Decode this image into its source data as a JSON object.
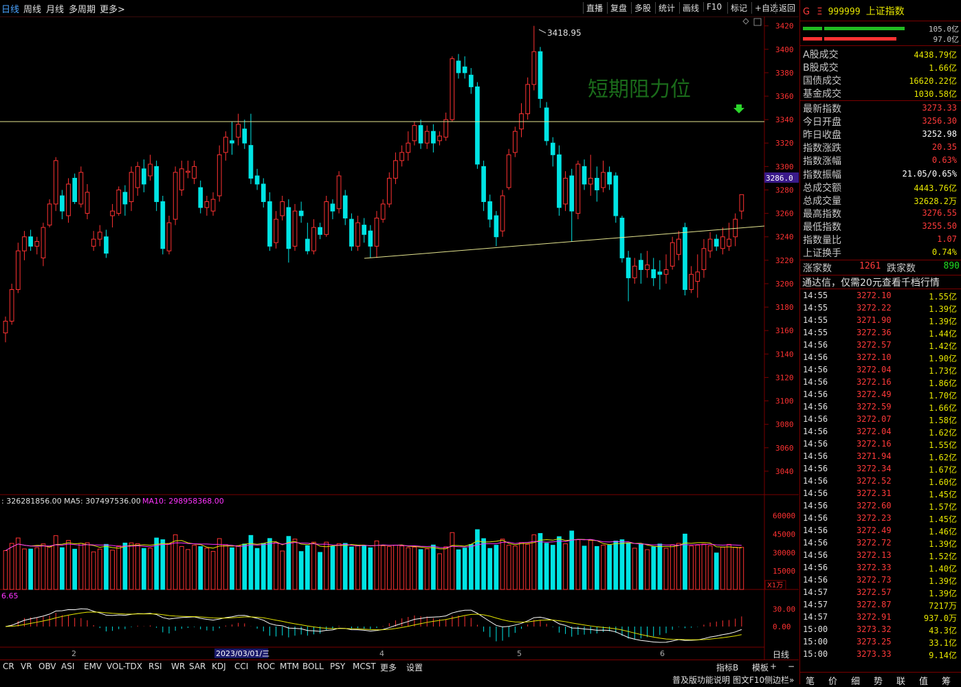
{
  "toolbar": {
    "periods": [
      "日线",
      "周线",
      "月线",
      "多周期",
      "更多>"
    ],
    "tools": [
      "直播",
      "复盘",
      "多股",
      "统计",
      "画线",
      "F10",
      "标记",
      "+自选",
      "返回"
    ]
  },
  "chart": {
    "annotation_text": "短期阻力位",
    "peak_label": "3418.95",
    "current_price_label": "3286.0",
    "volume_legend": {
      "vol": ": 326281856.00",
      "ma5": "MA5: 307497536.00",
      "ma10": "MA10: 298958368.00"
    },
    "volume_unit": "X1万",
    "macd_value": "6.65",
    "date_label": "2023/03/01/三",
    "month_labels": [
      "2",
      "4",
      "5",
      "6"
    ],
    "period_label": "日线",
    "colors": {
      "up": "#ff3232",
      "down": "#00e4e4",
      "ma5": "#ffffff",
      "ma10": "#e6e600",
      "ma20": "#ff33ff",
      "resistance": "#e6e690",
      "annotation": "#1a6b1a"
    }
  },
  "chart_data": {
    "type": "candlestick",
    "y_ticks": [
      3420,
      3400,
      3380,
      3360,
      3340,
      3320,
      3300,
      3280,
      3260,
      3240,
      3220,
      3200,
      3180,
      3160,
      3140,
      3120,
      3100,
      3080,
      3060,
      3040
    ],
    "ylim": [
      3020,
      3428
    ],
    "volume_ticks": [
      "60000",
      "45000",
      "30000",
      "15000"
    ],
    "macd_ticks": [
      "30.00",
      "0.00"
    ],
    "candles": [
      [
        3158,
        3168,
        3150,
        3172
      ],
      [
        3168,
        3195,
        3165,
        3200
      ],
      [
        3195,
        3228,
        3192,
        3235
      ],
      [
        3228,
        3240,
        3220,
        3245
      ],
      [
        3240,
        3232,
        3228,
        3246
      ],
      [
        3232,
        3236,
        3225,
        3240
      ],
      [
        3222,
        3248,
        3215,
        3252
      ],
      [
        3250,
        3268,
        3248,
        3272
      ],
      [
        3268,
        3305,
        3262,
        3308
      ],
      [
        3275,
        3262,
        3255,
        3280
      ],
      [
        3258,
        3285,
        3252,
        3290
      ],
      [
        3290,
        3270,
        3268,
        3294
      ],
      [
        3268,
        3295,
        3265,
        3300
      ],
      [
        3260,
        3278,
        3255,
        3285
      ],
      [
        3232,
        3238,
        3228,
        3245
      ],
      [
        3238,
        3244,
        3232,
        3250
      ],
      [
        3240,
        3226,
        3222,
        3246
      ],
      [
        3258,
        3262,
        3248,
        3268
      ],
      [
        3260,
        3280,
        3258,
        3283
      ],
      [
        3278,
        3268,
        3258,
        3284
      ],
      [
        3270,
        3295,
        3262,
        3300
      ],
      [
        3282,
        3300,
        3275,
        3304
      ],
      [
        3298,
        3285,
        3278,
        3306
      ],
      [
        3292,
        3302,
        3288,
        3310
      ],
      [
        3300,
        3270,
        3262,
        3305
      ],
      [
        3270,
        3230,
        3225,
        3275
      ],
      [
        3228,
        3252,
        3225,
        3258
      ],
      [
        3255,
        3295,
        3250,
        3300
      ],
      [
        3280,
        3298,
        3275,
        3305
      ],
      [
        3295,
        3296,
        3290,
        3305
      ],
      [
        3290,
        3300,
        3285,
        3305
      ],
      [
        3282,
        3265,
        3260,
        3288
      ],
      [
        3265,
        3270,
        3258,
        3275
      ],
      [
        3262,
        3272,
        3258,
        3278
      ],
      [
        3275,
        3310,
        3270,
        3318
      ],
      [
        3312,
        3325,
        3305,
        3330
      ],
      [
        3322,
        3320,
        3310,
        3338
      ],
      [
        3325,
        3336,
        3318,
        3345
      ],
      [
        3332,
        3320,
        3315,
        3340
      ],
      [
        3318,
        3290,
        3285,
        3345
      ],
      [
        3292,
        3285,
        3280,
        3298
      ],
      [
        3285,
        3270,
        3265,
        3290
      ],
      [
        3270,
        3232,
        3228,
        3278
      ],
      [
        3235,
        3255,
        3230,
        3262
      ],
      [
        3258,
        3270,
        3254,
        3275
      ],
      [
        3265,
        3230,
        3218,
        3272
      ],
      [
        3232,
        3262,
        3228,
        3268
      ],
      [
        3262,
        3258,
        3252,
        3270
      ],
      [
        3238,
        3228,
        3225,
        3252
      ],
      [
        3228,
        3248,
        3225,
        3255
      ],
      [
        3248,
        3242,
        3238,
        3252
      ],
      [
        3242,
        3270,
        3240,
        3275
      ],
      [
        3268,
        3262,
        3255,
        3272
      ],
      [
        3264,
        3292,
        3260,
        3296
      ],
      [
        3275,
        3256,
        3250,
        3280
      ],
      [
        3255,
        3232,
        3228,
        3260
      ],
      [
        3232,
        3252,
        3228,
        3258
      ],
      [
        3250,
        3242,
        3235,
        3256
      ],
      [
        3245,
        3232,
        3222,
        3250
      ],
      [
        3232,
        3256,
        3222,
        3262
      ],
      [
        3255,
        3268,
        3252,
        3272
      ],
      [
        3268,
        3290,
        3265,
        3295
      ],
      [
        3290,
        3305,
        3285,
        3312
      ],
      [
        3305,
        3312,
        3300,
        3318
      ],
      [
        3312,
        3320,
        3305,
        3330
      ],
      [
        3322,
        3335,
        3318,
        3338
      ],
      [
        3335,
        3320,
        3315,
        3340
      ],
      [
        3320,
        3330,
        3315,
        3335
      ],
      [
        3330,
        3320,
        3312,
        3336
      ],
      [
        3322,
        3326,
        3318,
        3330
      ],
      [
        3325,
        3340,
        3322,
        3346
      ],
      [
        3340,
        3392,
        3338,
        3394
      ],
      [
        3390,
        3380,
        3375,
        3396
      ],
      [
        3385,
        3380,
        3375,
        3394
      ],
      [
        3378,
        3368,
        3362,
        3384
      ],
      [
        3368,
        3302,
        3298,
        3372
      ],
      [
        3300,
        3270,
        3262,
        3305
      ],
      [
        3270,
        3255,
        3248,
        3276
      ],
      [
        3258,
        3240,
        3232,
        3262
      ],
      [
        3245,
        3275,
        3240,
        3280
      ],
      [
        3282,
        3310,
        3280,
        3315
      ],
      [
        3312,
        3330,
        3308,
        3334
      ],
      [
        3332,
        3345,
        3325,
        3354
      ],
      [
        3345,
        3370,
        3340,
        3376
      ],
      [
        3370,
        3398,
        3365,
        3420
      ],
      [
        3398,
        3358,
        3350,
        3402
      ],
      [
        3350,
        3322,
        3318,
        3355
      ],
      [
        3320,
        3310,
        3300,
        3325
      ],
      [
        3310,
        3265,
        3258,
        3318
      ],
      [
        3268,
        3290,
        3262,
        3296
      ],
      [
        3292,
        3262,
        3236,
        3298
      ],
      [
        3260,
        3302,
        3255,
        3305
      ],
      [
        3300,
        3285,
        3280,
        3306
      ],
      [
        3285,
        3290,
        3275,
        3310
      ],
      [
        3290,
        3280,
        3270,
        3300
      ],
      [
        3282,
        3295,
        3278,
        3305
      ],
      [
        3295,
        3285,
        3280,
        3300
      ],
      [
        3292,
        3258,
        3252,
        3295
      ],
      [
        3256,
        3222,
        3218,
        3258
      ],
      [
        3222,
        3205,
        3185,
        3228
      ],
      [
        3205,
        3215,
        3200,
        3222
      ],
      [
        3220,
        3212,
        3200,
        3226
      ],
      [
        3212,
        3216,
        3205,
        3228
      ],
      [
        3212,
        3205,
        3198,
        3222
      ],
      [
        3210,
        3208,
        3195,
        3220
      ],
      [
        3208,
        3212,
        3200,
        3225
      ],
      [
        3215,
        3235,
        3212,
        3240
      ],
      [
        3225,
        3238,
        3220,
        3245
      ],
      [
        3248,
        3195,
        3190,
        3252
      ],
      [
        3195,
        3208,
        3192,
        3215
      ],
      [
        3202,
        3210,
        3188,
        3225
      ],
      [
        3212,
        3230,
        3205,
        3238
      ],
      [
        3228,
        3238,
        3222,
        3244
      ],
      [
        3238,
        3232,
        3228,
        3242
      ],
      [
        3230,
        3240,
        3225,
        3248
      ],
      [
        3232,
        3238,
        3228,
        3252
      ],
      [
        3240,
        3255,
        3232,
        3260
      ],
      [
        3262,
        3276,
        3255,
        3276
      ]
    ]
  },
  "panel": {
    "header": {
      "flag": "G",
      "menu": "Ξ",
      "code": "999999",
      "name": "上证指数"
    },
    "bars": [
      "105.0亿",
      "97.0亿"
    ],
    "turnover": [
      {
        "label": "A股成交",
        "value": "4438.79亿"
      },
      {
        "label": "B股成交",
        "value": "1.66亿"
      },
      {
        "label": "国债成交",
        "value": "16620.22亿"
      },
      {
        "label": "基金成交",
        "value": "1030.58亿"
      }
    ],
    "stats": [
      {
        "label": "最新指数",
        "value": "3273.33",
        "color": "#ff3a3a"
      },
      {
        "label": "今日开盘",
        "value": "3256.30",
        "color": "#ff3a3a"
      },
      {
        "label": "昨日收盘",
        "value": "3252.98",
        "color": "#ffffff"
      },
      {
        "label": "指数涨跌",
        "value": "20.35",
        "color": "#ff3a3a"
      },
      {
        "label": "指数涨幅",
        "value": "0.63%",
        "color": "#ff3a3a"
      },
      {
        "label": "指数振幅",
        "value": "21.05/0.65%",
        "color": "#ffffff"
      },
      {
        "label": "总成交额",
        "value": "4443.76亿",
        "color": "#e6e600"
      },
      {
        "label": "总成交量",
        "value": "32628.2万",
        "color": "#e6e600"
      },
      {
        "label": "最高指数",
        "value": "3276.55",
        "color": "#ff3a3a"
      },
      {
        "label": "最低指数",
        "value": "3255.50",
        "color": "#ff3a3a"
      },
      {
        "label": "指数量比",
        "value": "1.07",
        "color": "#ff3a3a"
      },
      {
        "label": "上证换手",
        "value": "0.74%",
        "color": "#e6e600"
      }
    ],
    "breadth": {
      "up_label": "涨家数",
      "up": "1261",
      "down_label": "跌家数",
      "down": "890"
    },
    "ad_text": "通达信，仅需20元查看千档行情",
    "ticks": [
      [
        "14:55",
        "3272.10",
        "1.55亿"
      ],
      [
        "14:55",
        "3272.22",
        "1.39亿"
      ],
      [
        "14:55",
        "3271.90",
        "1.39亿"
      ],
      [
        "14:55",
        "3272.36",
        "1.44亿"
      ],
      [
        "14:56",
        "3272.57",
        "1.42亿"
      ],
      [
        "14:56",
        "3272.10",
        "1.90亿"
      ],
      [
        "14:56",
        "3272.04",
        "1.73亿"
      ],
      [
        "14:56",
        "3272.16",
        "1.86亿"
      ],
      [
        "14:56",
        "3272.49",
        "1.70亿"
      ],
      [
        "14:56",
        "3272.59",
        "1.66亿"
      ],
      [
        "14:56",
        "3272.07",
        "1.58亿"
      ],
      [
        "14:56",
        "3272.04",
        "1.62亿"
      ],
      [
        "14:56",
        "3272.16",
        "1.55亿"
      ],
      [
        "14:56",
        "3271.94",
        "1.62亿"
      ],
      [
        "14:56",
        "3272.34",
        "1.67亿"
      ],
      [
        "14:56",
        "3272.52",
        "1.60亿"
      ],
      [
        "14:56",
        "3272.31",
        "1.45亿"
      ],
      [
        "14:56",
        "3272.60",
        "1.57亿"
      ],
      [
        "14:56",
        "3272.23",
        "1.45亿"
      ],
      [
        "14:56",
        "3272.49",
        "1.46亿"
      ],
      [
        "14:56",
        "3272.72",
        "1.39亿"
      ],
      [
        "14:56",
        "3272.13",
        "1.52亿"
      ],
      [
        "14:56",
        "3272.33",
        "1.40亿"
      ],
      [
        "14:56",
        "3272.73",
        "1.39亿"
      ],
      [
        "14:57",
        "3272.57",
        "1.39亿"
      ],
      [
        "14:57",
        "3272.87",
        "7217万"
      ],
      [
        "14:57",
        "3272.91",
        "937.0万"
      ],
      [
        "15:00",
        "3273.32",
        "43.3亿"
      ],
      [
        "15:00",
        "3273.25",
        "33.1亿"
      ],
      [
        "15:00",
        "3273.33",
        "9.14亿"
      ]
    ],
    "tabs": [
      "笔",
      "价",
      "细",
      "势",
      "联",
      "值",
      "筹"
    ]
  },
  "bottom": {
    "indicators": [
      "CR",
      "VR",
      "OBV",
      "ASI",
      "EMV",
      "VOL-TDX",
      "RSI",
      "WR",
      "SAR",
      "KDJ",
      "CCI",
      "ROC",
      "MTM",
      "BOLL",
      "PSY",
      "MCST",
      "更多",
      "设置"
    ],
    "right_items": [
      "指标B",
      "模板",
      "+",
      "−"
    ],
    "status": "普及版功能说明",
    "status2": "图文F10",
    "status3": "侧边栏»"
  }
}
